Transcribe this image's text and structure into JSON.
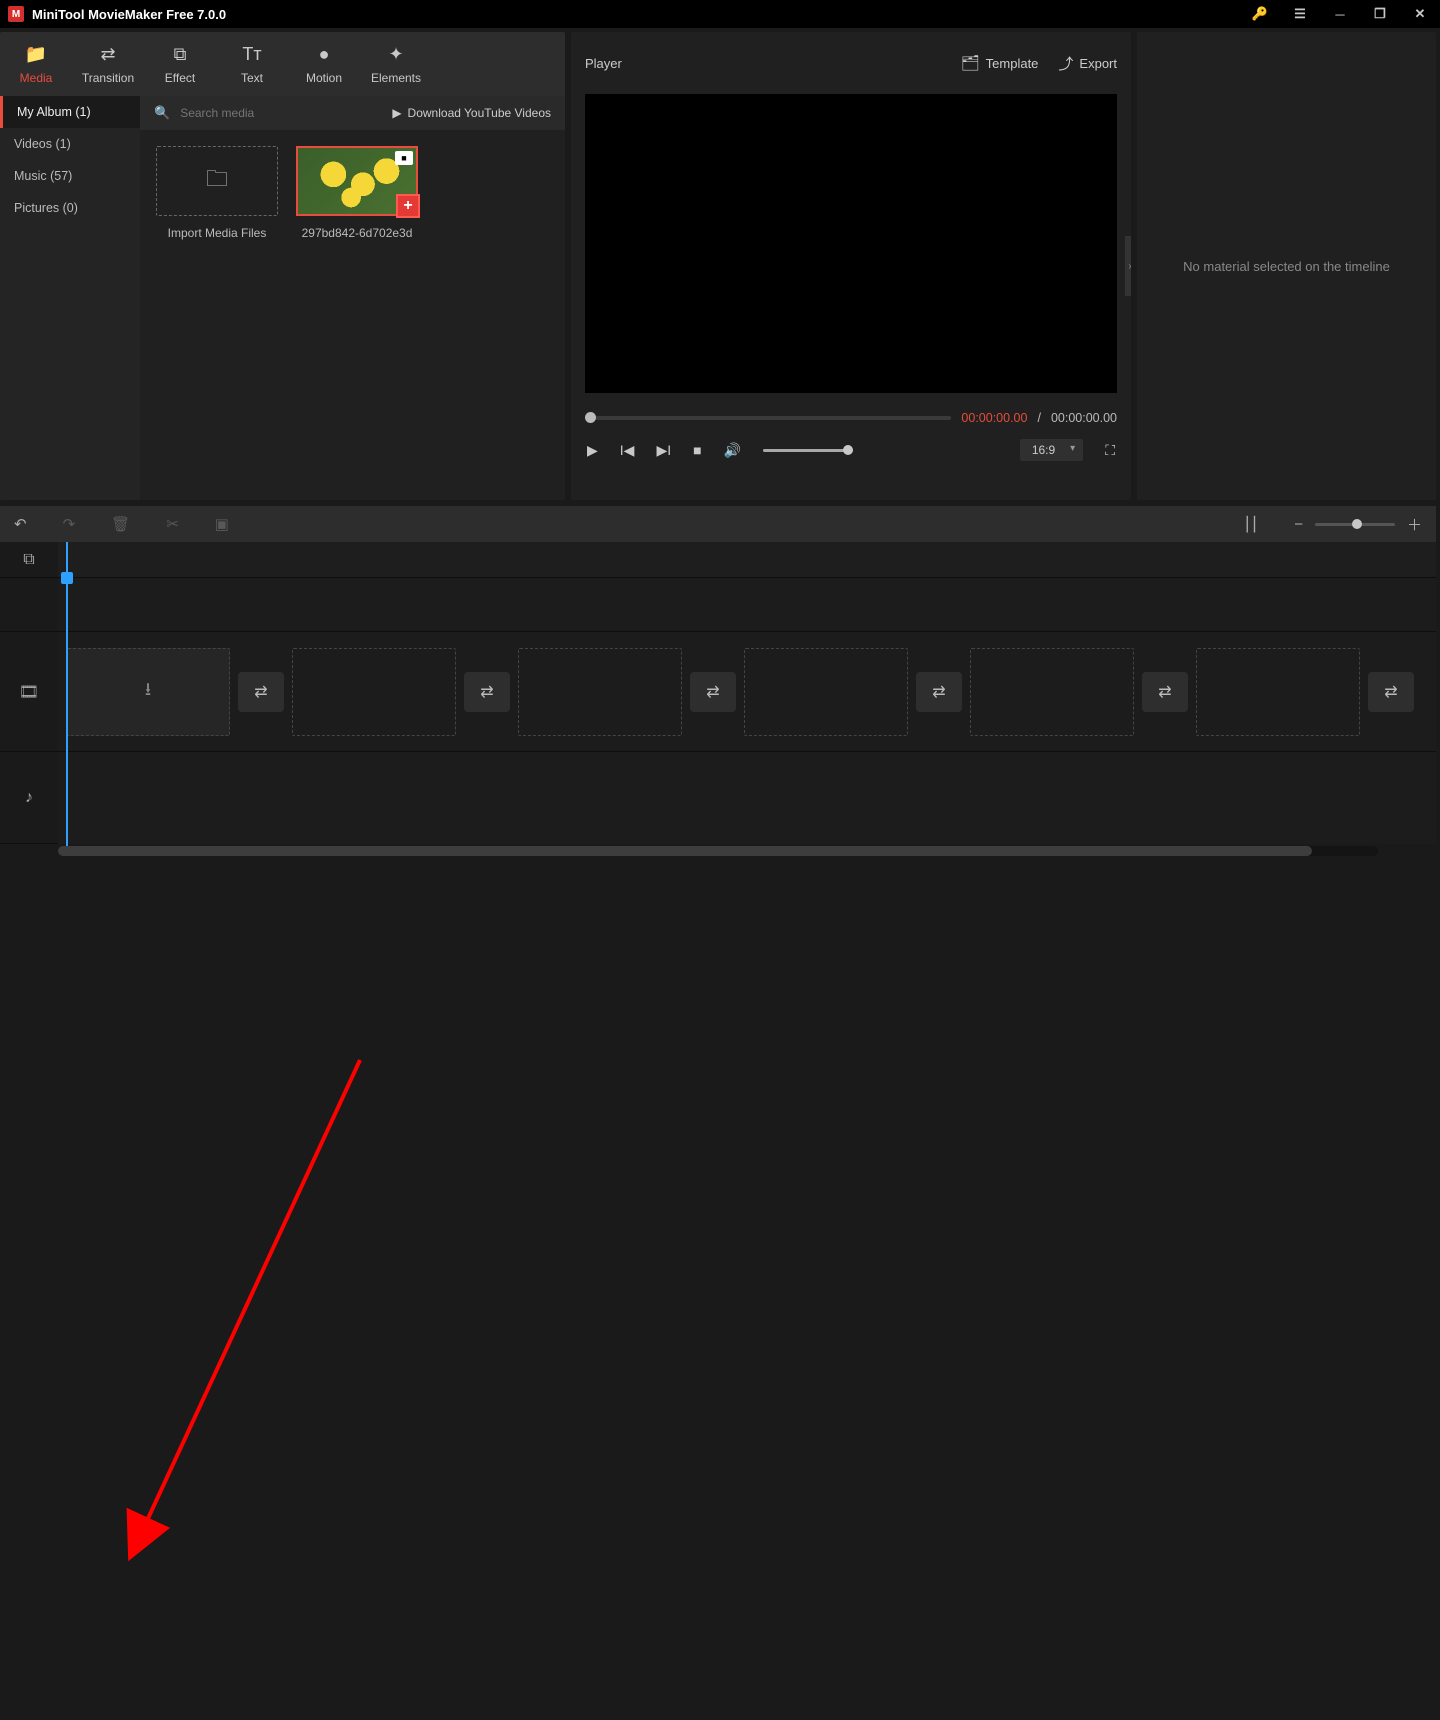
{
  "titlebar": {
    "title": "MiniTool MovieMaker Free 7.0.0"
  },
  "ribbon": {
    "tabs": [
      {
        "label": "Media",
        "icon": "📁",
        "active": true
      },
      {
        "label": "Transition",
        "icon": "⇄"
      },
      {
        "label": "Effect",
        "icon": "⧉"
      },
      {
        "label": "Text",
        "icon": "Tᴛ"
      },
      {
        "label": "Motion",
        "icon": "●"
      },
      {
        "label": "Elements",
        "icon": "✦"
      }
    ]
  },
  "media_sidebar": {
    "items": [
      {
        "label": "My Album (1)",
        "active": true
      },
      {
        "label": "Videos (1)"
      },
      {
        "label": "Music (57)"
      },
      {
        "label": "Pictures (0)"
      }
    ]
  },
  "media_toolbar": {
    "search_placeholder": "Search media",
    "download_label": "Download YouTube Videos"
  },
  "media_grid": {
    "import_label": "Import Media Files",
    "items": [
      {
        "name": "297bd842-6d702e3d"
      }
    ]
  },
  "player": {
    "title": "Player",
    "template_label": "Template",
    "export_label": "Export",
    "time_current": "00:00:00.00",
    "time_sep": "/",
    "time_total": "00:00:00.00",
    "ratio": "16:9"
  },
  "properties": {
    "empty_message": "No material selected on the timeline"
  },
  "timeline": {
    "slot_count": 6
  }
}
